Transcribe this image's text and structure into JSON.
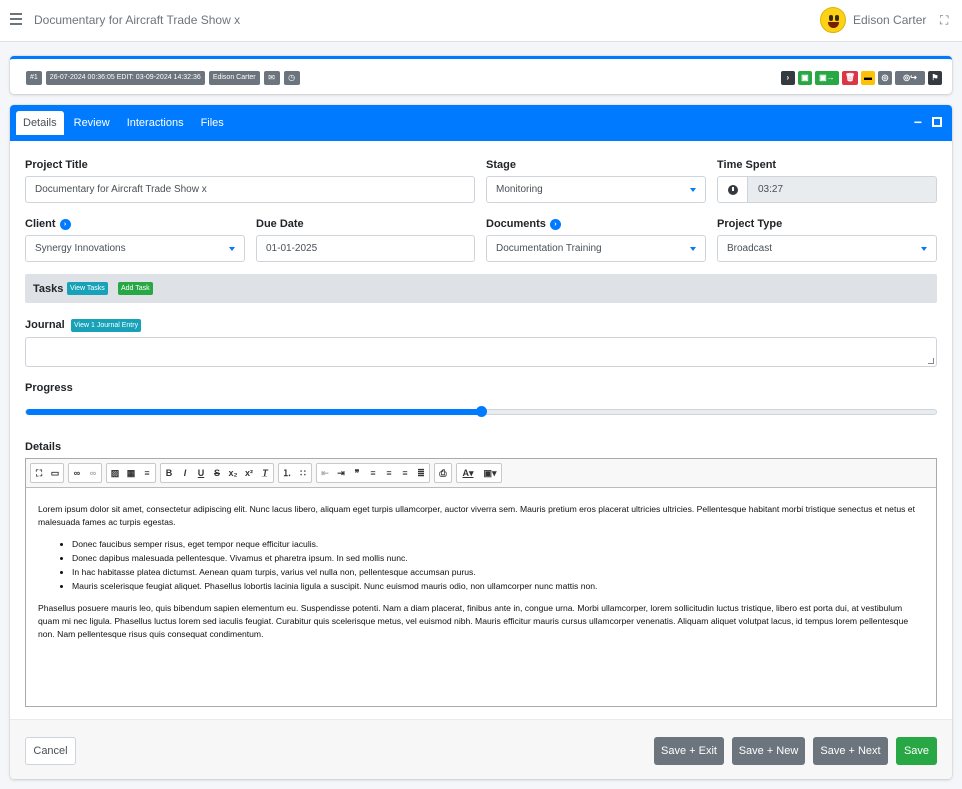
{
  "navbar": {
    "title": "Documentary for Aircraft Trade Show x",
    "user_name": "Edison Carter"
  },
  "meta": {
    "id_badge": "#1",
    "dates_badge": "26-07-2024 00:36:05 EDIT: 03-09-2024 14:32:36",
    "user_badge": "Edison Carter"
  },
  "tabs": [
    {
      "label": "Details"
    },
    {
      "label": "Review"
    },
    {
      "label": "Interactions"
    },
    {
      "label": "Files"
    }
  ],
  "form": {
    "project_title_label": "Project Title",
    "project_title_value": "Documentary for Aircraft Trade Show x",
    "stage_label": "Stage",
    "stage_value": "Monitoring",
    "time_spent_label": "Time Spent",
    "time_spent_value": "03:27",
    "client_label": "Client",
    "client_value": "Synergy Innovations",
    "due_date_label": "Due Date",
    "due_date_value": "01-01-2025",
    "documents_label": "Documents",
    "documents_value": "Documentation Training",
    "project_type_label": "Project Type",
    "project_type_value": "Broadcast",
    "tasks_label": "Tasks",
    "view_tasks": "View Tasks",
    "add_task": "Add Task",
    "journal_label": "Journal",
    "journal_entry_badge": "View 1 Journal Entry",
    "progress_label": "Progress",
    "progress_percent": 50,
    "details_label": "Details"
  },
  "editor": {
    "para1": "Lorem ipsum dolor sit amet, consectetur adipiscing elit. Nunc lacus libero, aliquam eget turpis ullamcorper, auctor viverra sem. Mauris pretium eros placerat ultricies ultricies. Pellentesque habitant morbi tristique senectus et netus et malesuada fames ac turpis egestas.",
    "bullets": [
      "Donec faucibus semper risus, eget tempor neque efficitur iaculis.",
      "Donec dapibus malesuada pellentesque. Vivamus et pharetra ipsum. In sed mollis nunc.",
      "In hac habitasse platea dictumst. Aenean quam turpis, varius vel nulla non, pellentesque accumsan purus.",
      "Mauris scelerisque feugiat aliquet. Phasellus lobortis lacinia ligula a suscipit. Nunc euismod mauris odio, non ullamcorper nunc mattis non."
    ],
    "para2": "Phasellus posuere mauris leo, quis bibendum sapien elementum eu. Suspendisse potenti. Nam a diam placerat, finibus ante in, congue urna. Morbi ullamcorper, lorem sollicitudin luctus tristique, libero est porta dui, at vestibulum quam mi nec ligula. Phasellus luctus lorem sed iaculis feugiat. Curabitur quis scelerisque metus, vel euismod nibh. Mauris efficitur mauris cursus ullamcorper venenatis. Aliquam aliquet volutpat lacus, id tempus lorem pellentesque non. Nam pellentesque risus quis consequat condimentum."
  },
  "footer": {
    "cancel": "Cancel",
    "save_exit": "Save + Exit",
    "save_new": "Save + New",
    "save_next": "Save + Next",
    "save": "Save"
  },
  "colors": {
    "primary": "#007bff",
    "success": "#28a745",
    "danger": "#dc3545",
    "warning": "#ffc107",
    "secondary": "#6c757d"
  }
}
